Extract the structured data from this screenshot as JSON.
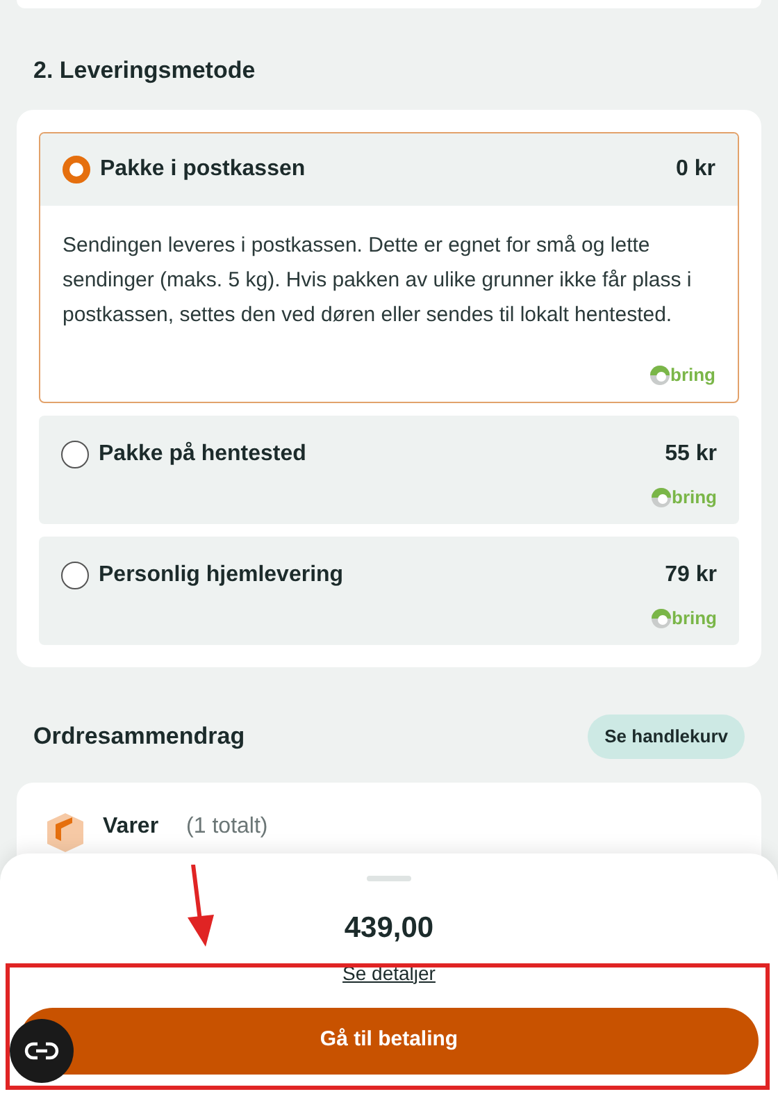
{
  "delivery": {
    "title": "2. Leveringsmetode",
    "options": [
      {
        "name": "Pakke i postkassen",
        "price": "0 kr",
        "selected": true,
        "description": "Sendingen leveres i postkassen. Dette er egnet for små og lette sendinger (maks. 5 kg). Hvis pakken av ulike grunner ikke får plass i postkassen, settes den ved døren eller sendes til lokalt hentested.",
        "carrier": "bring"
      },
      {
        "name": "Pakke på hentested",
        "price": "55 kr",
        "selected": false,
        "carrier": "bring"
      },
      {
        "name": "Personlig hjemlevering",
        "price": "79 kr",
        "selected": false,
        "carrier": "bring"
      }
    ]
  },
  "summary": {
    "title": "Ordresammendrag",
    "cart_button": "Se handlekurv",
    "items_label": "Varer",
    "items_count": "(1 totalt)"
  },
  "footer": {
    "total": "439,00",
    "details_link": "Se detaljer",
    "pay_button": "Gå til betaling"
  }
}
